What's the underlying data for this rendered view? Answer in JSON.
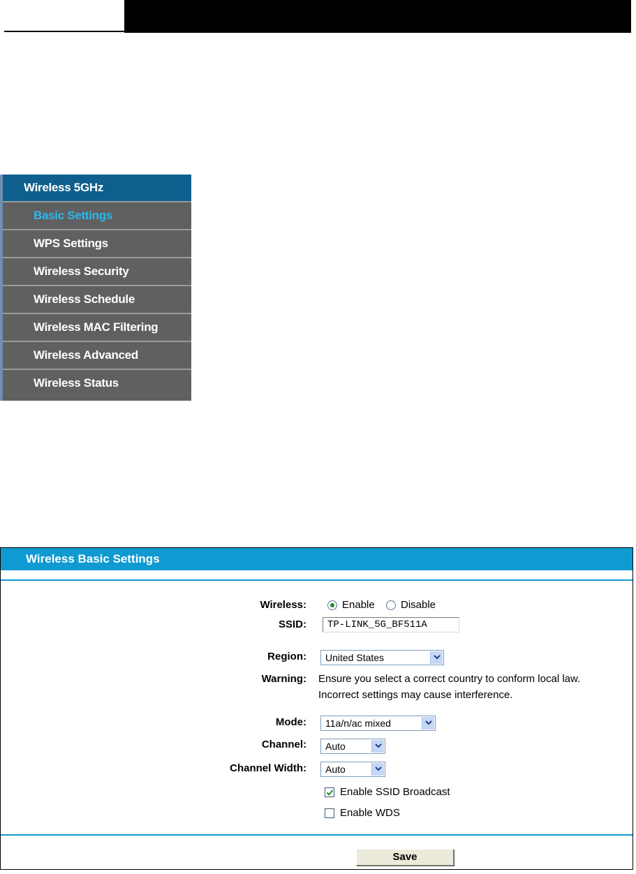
{
  "menu": {
    "header": "Wireless 5GHz",
    "items": [
      {
        "label": "Basic Settings",
        "active": true
      },
      {
        "label": "WPS Settings",
        "active": false
      },
      {
        "label": "Wireless Security",
        "active": false
      },
      {
        "label": "Wireless Schedule",
        "active": false
      },
      {
        "label": "Wireless MAC Filtering",
        "active": false
      },
      {
        "label": "Wireless Advanced",
        "active": false
      },
      {
        "label": "Wireless Status",
        "active": false
      }
    ]
  },
  "panel": {
    "title": "Wireless Basic Settings",
    "wireless_label": "Wireless:",
    "enable_label": "Enable",
    "disable_label": "Disable",
    "wireless_state": "Enable",
    "ssid_label": "SSID:",
    "ssid_value": "TP-LINK_5G_BF511A",
    "region_label": "Region:",
    "region_value": "United States",
    "warning_label": "Warning:",
    "warning_line1": "Ensure you select a correct country to conform local law.",
    "warning_line2": "Incorrect settings may cause interference.",
    "mode_label": "Mode:",
    "mode_value": "11a/n/ac mixed",
    "channel_label": "Channel:",
    "channel_value": "Auto",
    "width_label": "Channel Width:",
    "width_value": "Auto",
    "ssid_broadcast_label": "Enable SSID Broadcast",
    "ssid_broadcast_checked": true,
    "wds_label": "Enable WDS",
    "wds_checked": false,
    "save_label": "Save"
  },
  "colors": {
    "menu_header": "#0e5f8d",
    "menu_bg": "#606060",
    "menu_active_text": "#27b8ee",
    "panel_accent": "#0f9ad1"
  }
}
